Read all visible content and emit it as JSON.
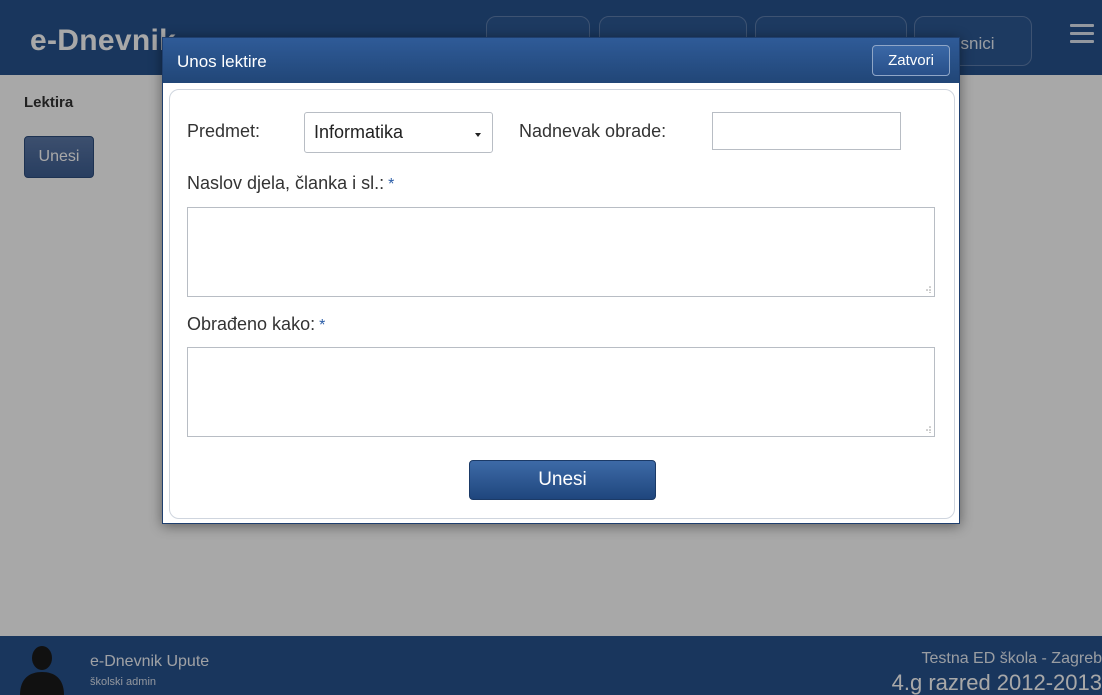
{
  "app": {
    "brand": "e-Dnevnik",
    "nav_tabs": [
      "",
      "",
      "",
      "Upisnici"
    ],
    "page_title": "Lektira",
    "unesi_label": "Unesi"
  },
  "footer": {
    "link": "e-Dnevnik Upute",
    "role": "školski admin",
    "school": "Testna ED škola - Zagreb",
    "class_year": "4.g razred 2012-2013"
  },
  "modal": {
    "title": "Unos lektire",
    "close_label": "Zatvori",
    "subject_label": "Predmet:",
    "subject_value": "Informatika",
    "date_label": "Nadnevak obrade:",
    "date_value": "",
    "title_field_label": "Naslov djela, članka i sl.:",
    "title_field_value": "",
    "processed_label": "Obrađeno kako:",
    "processed_value": "",
    "required_mark": "*",
    "submit_label": "Unesi"
  },
  "colors": {
    "primary": "#27528e",
    "required": "#2a5ca7"
  },
  "icons": {
    "menu": "hamburger-menu-icon",
    "avatar": "user-silhouette-icon",
    "select_caret": "caret-down-icon"
  }
}
